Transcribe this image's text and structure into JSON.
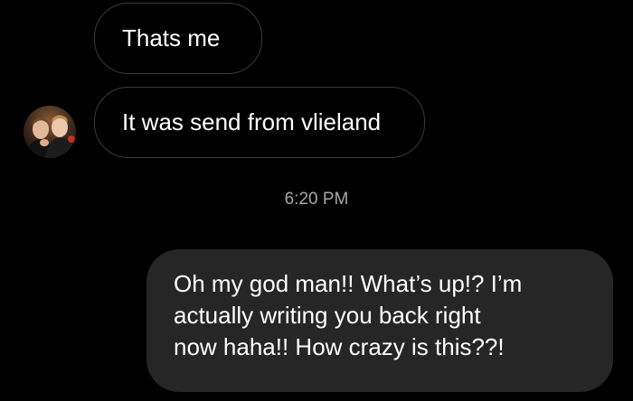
{
  "conversation": {
    "incoming": [
      {
        "text": "Thats me"
      },
      {
        "text": "It was send from vlieland"
      }
    ],
    "timestamp": "6:20 PM",
    "outgoing": {
      "lines": [
        "Oh my god man!! What’s up!? I’m",
        "actually writing you back right",
        "now haha!! How crazy is this??!"
      ]
    }
  },
  "avatar": {
    "icon": "profile-photo-icon"
  },
  "colors": {
    "background": "#000000",
    "incoming_border": "#3a3a3a",
    "outgoing_bubble": "#262626",
    "timestamp_text": "#a7a7a7",
    "text": "#ffffff"
  }
}
